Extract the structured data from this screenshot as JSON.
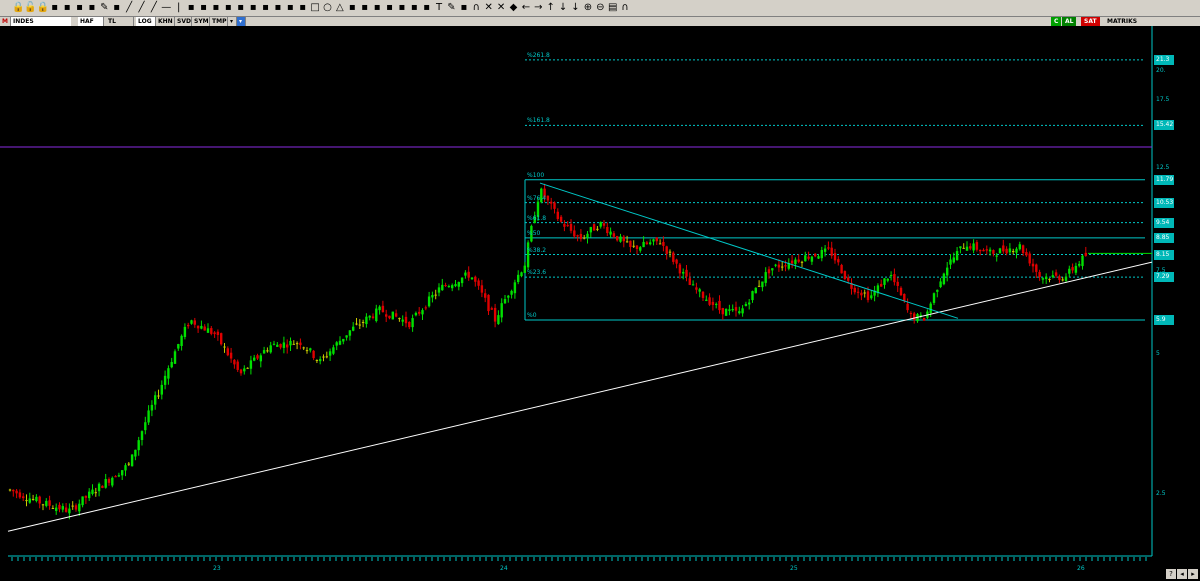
{
  "toolbar": {
    "icons": [
      "lock-icon",
      "lock-open-icon",
      "lock-icon",
      "chain-icon",
      "wrench-icon",
      "tools-icon",
      "hand-icon",
      "pen-icon",
      "dart-icon",
      "line-icon",
      "line-icon",
      "line-icon",
      "hline-icon",
      "vline-icon",
      "ray-icon",
      "trend-icon",
      "channel-icon",
      "fib-icon",
      "fib-icon",
      "fib-icon",
      "fib-icon",
      "fib-icon",
      "arc-icon",
      "fan-icon",
      "box-icon",
      "ellipse-icon",
      "triangle-icon",
      "gann-icon",
      "gann-icon",
      "gann-icon",
      "gann-icon",
      "gann-icon",
      "pitch-icon",
      "pitch-icon",
      "text-icon",
      "note-icon",
      "marker-icon",
      "magnet-icon",
      "cross-icon",
      "cross-icon",
      "diamond-icon",
      "arrow-left-icon",
      "arrow-right-icon",
      "arrow-up-icon",
      "arrow-down-icon",
      "arrow-down-icon",
      "zoom-in-icon",
      "zoom-out-icon",
      "print-icon",
      "magnet-icon"
    ]
  },
  "menubar": {
    "logo": "M",
    "symbol": "INDES",
    "items": [
      "HAF",
      "TL",
      "LOG",
      "KHN",
      "SVD",
      "SYM",
      "TMP"
    ],
    "pills": [
      {
        "label": "C",
        "color": "#00a000"
      },
      {
        "label": "AL",
        "color": "#008000"
      },
      {
        "label": "SAT",
        "color": "#d00000"
      }
    ],
    "brand": "MATRIKS"
  },
  "chart_data": {
    "type": "candlestick",
    "scale": "log",
    "ylim": [
      1.9,
      23
    ],
    "x_labels": [
      "23",
      "24",
      "25",
      "26"
    ],
    "y_ticks": [
      "17.5",
      "12.5",
      "7.5",
      "5",
      "2.5"
    ],
    "price_tags": [
      {
        "label": "21.3",
        "color": "#00b8b8"
      },
      {
        "label": "20.",
        "color": "#000000"
      },
      {
        "label": "15.42",
        "color": "#00b8b8"
      },
      {
        "label": "11.79",
        "color": "#00b8b8"
      },
      {
        "label": "10.53",
        "color": "#00b8b8"
      },
      {
        "label": "9.54",
        "color": "#00b8b8"
      },
      {
        "label": "8.85",
        "color": "#00b8b8"
      },
      {
        "label": "8.15",
        "color": "#00b8b8"
      },
      {
        "label": "7.29",
        "color": "#00b8b8"
      },
      {
        "label": "5.9",
        "color": "#00b8b8"
      }
    ],
    "fib_levels": [
      {
        "label": "%261.8",
        "value": 21.3
      },
      {
        "label": "%161.8",
        "value": 15.42
      },
      {
        "label": "%100",
        "value": 11.79
      },
      {
        "label": "%76.4",
        "value": 10.53
      },
      {
        "label": "%61.8",
        "value": 9.54
      },
      {
        "label": "%50",
        "value": 8.85
      },
      {
        "label": "%38.2",
        "value": 8.15
      },
      {
        "label": "%23.6",
        "value": 7.29
      },
      {
        "label": "%0",
        "value": 5.9
      }
    ],
    "last_price": 8.2,
    "colors": {
      "up": "#00e000",
      "down": "#e00000",
      "doji": "#c8c800",
      "fib": "#00c8c8",
      "trend": "#ffffff",
      "purple": "#8a2be2"
    }
  },
  "bottom": {
    "buttons": [
      "help-icon",
      "scroll-left-icon",
      "scroll-right-icon"
    ]
  }
}
